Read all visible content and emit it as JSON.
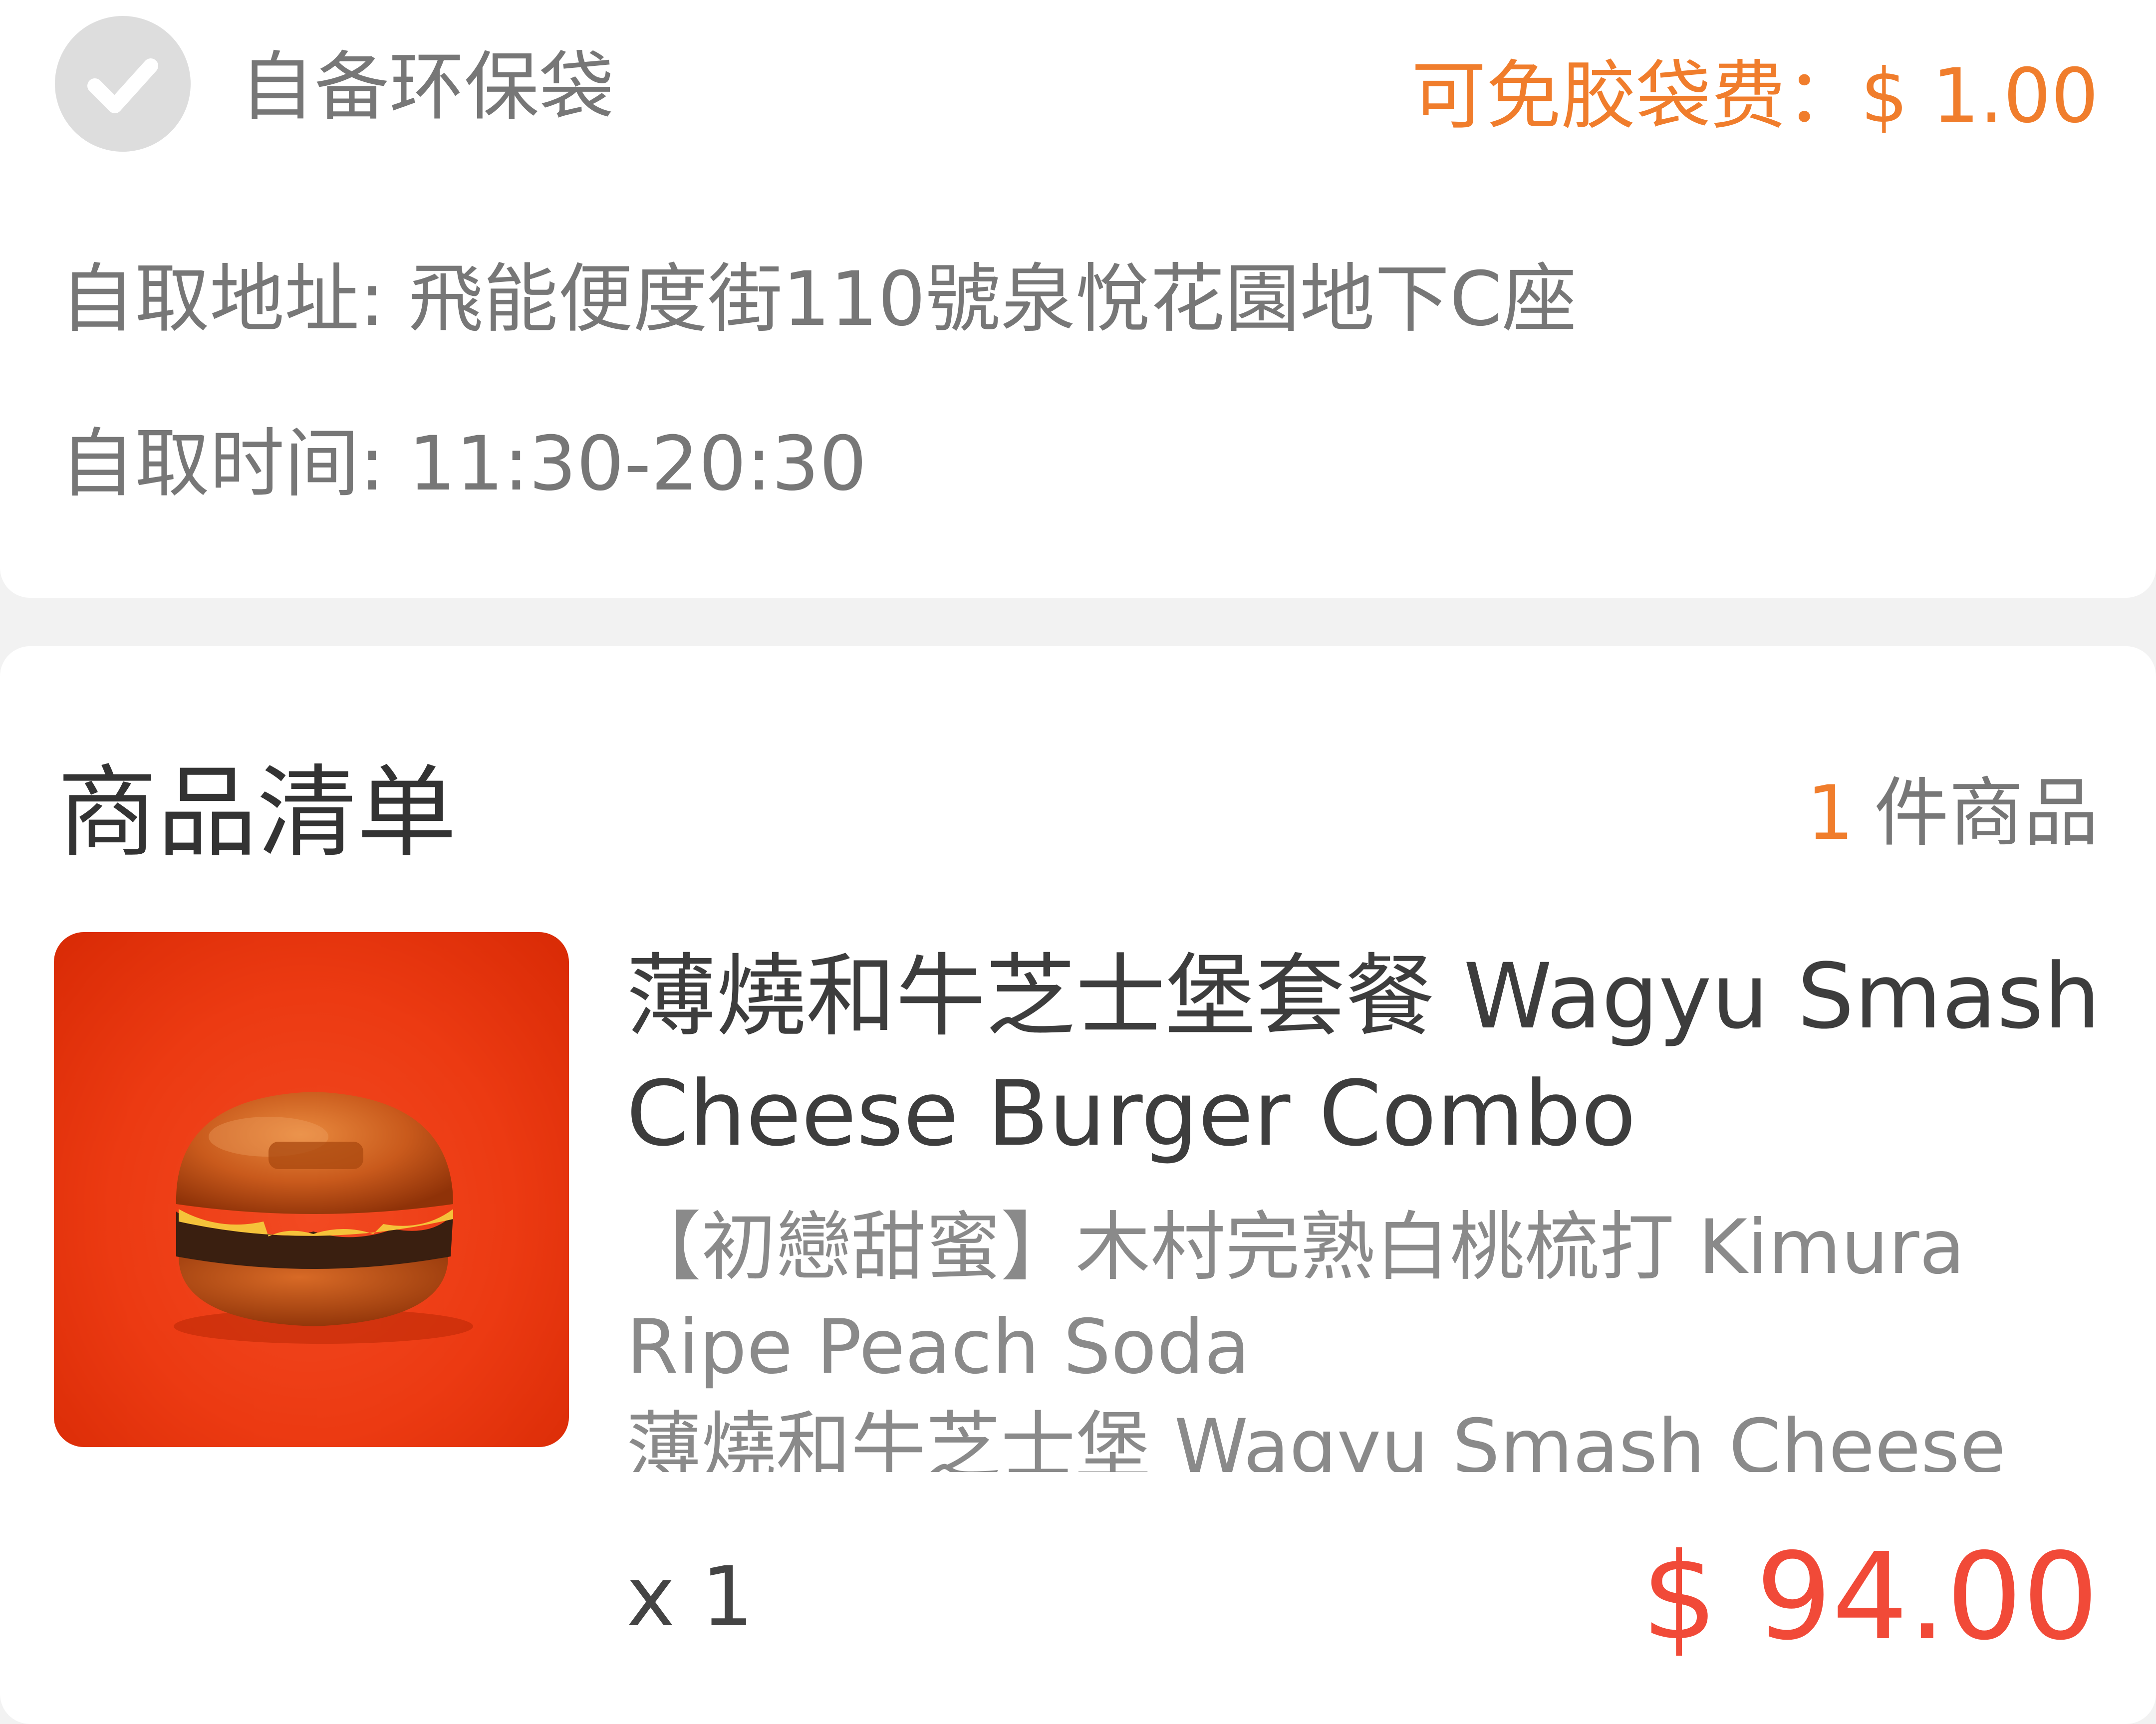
{
  "pickup": {
    "bag_label": "自备环保袋",
    "bag_fee": "可免胶袋费：$ 1.00",
    "address": "自取地址: 飛能便度街110號泉悅花園地下C座",
    "time": "自取时间: 11:30-20:30"
  },
  "order_list": {
    "title": "商品清单",
    "count_number": "1",
    "count_label": "件商品",
    "items": [
      {
        "name": "薄燒和牛芝士堡套餐 Wagyu Smash Cheese Burger Combo",
        "options": [
          "【初戀甜蜜】木村完熟白桃梳打 Kimura Ripe Peach Soda",
          "薄燒和牛芝士堡 Wagyu Smash Cheese"
        ],
        "quantity": "x 1",
        "price": "$ 94.00"
      }
    ]
  },
  "colors": {
    "accent_orange": "#f07d2c",
    "price_red": "#f14a38",
    "check_gray": "#dddddd",
    "product_bg": "#ec3a12"
  }
}
